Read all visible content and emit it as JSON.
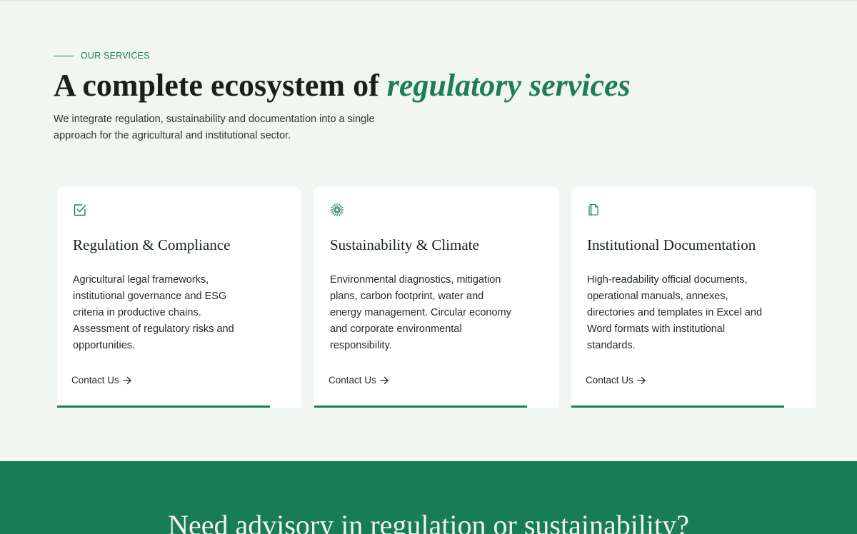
{
  "colors": {
    "accent": "#1d7d56",
    "page_background": "#f2f6f3",
    "card_background": "#ffffff",
    "band_background": "#187d57",
    "heading_text": "#16211b"
  },
  "section": {
    "eyebrow": "OUR SERVICES",
    "title_plain": "A complete ecosystem of ",
    "title_accent": "regulatory services",
    "lead": "We integrate regulation, sustainability and documentation into a single approach for the agricultural and institutional sector."
  },
  "cards": [
    {
      "icon": "checkbox-icon",
      "title": "Regulation & Compliance",
      "text": "Agricultural legal frameworks, institutional governance and ESG criteria in productive chains. Assessment of regulatory risks and opportunities.",
      "cta": "Contact Us",
      "cta_icon": "arrow-right-icon"
    },
    {
      "icon": "sun-icon",
      "title": "Sustainability & Climate",
      "text": "Environmental diagnostics, mitigation plans, carbon footprint, water and energy management. Circular economy and corporate environmental responsibility.",
      "cta": "Contact Us",
      "cta_icon": "arrow-right-icon"
    },
    {
      "icon": "documents-icon",
      "title": "Institutional Documentation",
      "text": "High-readability official documents, operational manuals, annexes, directories and templates in Excel and Word formats with institutional standards.",
      "cta": "Contact Us",
      "cta_icon": "arrow-right-icon"
    }
  ],
  "cta_band": {
    "heading": "Need advisory in regulation or sustainability?"
  }
}
